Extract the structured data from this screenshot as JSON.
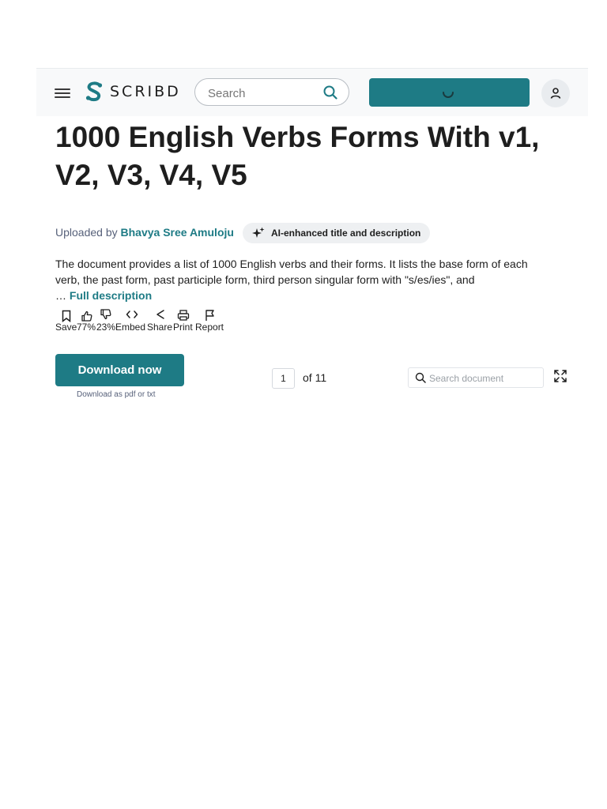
{
  "header": {
    "logo_text": "SCRIBD",
    "search_placeholder": "Search",
    "brand_color": "#1e7b85"
  },
  "document": {
    "title": "1000 English Verbs Forms With v1, V2, V3, V4, V5",
    "uploaded_by_label": "Uploaded by",
    "uploader": "Bhavya Sree Amuloju",
    "ai_badge": "AI-enhanced title and description",
    "description": "The document provides a list of 1000 English verbs and their forms. It lists the base form of each verb, the past form, past participle form, third person singular form with \"s/es/ies\", and",
    "ellipsis": "…",
    "full_description_link": "Full description"
  },
  "actions": [
    {
      "icon": "bookmark-icon",
      "label": "Save"
    },
    {
      "icon": "thumbs-up-icon",
      "label": "77%"
    },
    {
      "icon": "thumbs-down-icon",
      "label": "23%"
    },
    {
      "icon": "code-icon",
      "label": "Embed"
    },
    {
      "icon": "share-icon",
      "label": "Share"
    },
    {
      "icon": "print-icon",
      "label": "Print"
    },
    {
      "icon": "flag-icon",
      "label": "Report"
    }
  ],
  "download": {
    "button": "Download now",
    "subtext": "Download as pdf or txt"
  },
  "viewer": {
    "current_page": "1",
    "of_pages": "of 11",
    "search_placeholder": "Search document"
  }
}
